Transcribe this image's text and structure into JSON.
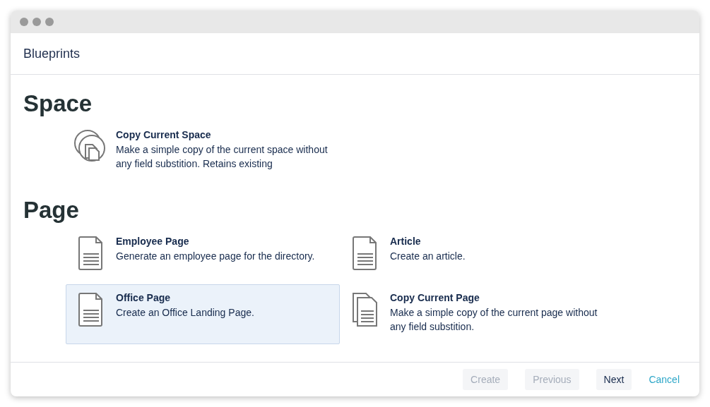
{
  "window": {
    "title": "Blueprints"
  },
  "sections": [
    {
      "heading": "Space",
      "items": [
        {
          "kind": "space",
          "title": "Copy Current Space",
          "description": "Make a simple copy of the current space without any field substition. Retains existing",
          "selected": false
        }
      ]
    },
    {
      "heading": "Page",
      "items": [
        {
          "kind": "page",
          "title": "Employee Page",
          "description": "Generate an employee page for the directory.",
          "selected": false
        },
        {
          "kind": "page",
          "title": "Article",
          "description": "Create an article.",
          "selected": false
        },
        {
          "kind": "page",
          "title": "Office Page",
          "description": "Create an Office Landing Page.",
          "selected": true
        },
        {
          "kind": "pages",
          "title": "Copy Current Page",
          "description": "Make a simple copy of the current page without any field substition.",
          "selected": false
        }
      ]
    }
  ],
  "buttons": [
    {
      "kind": "button",
      "label": "Create",
      "disabled": true
    },
    {
      "kind": "button",
      "label": "Previous",
      "disabled": true
    },
    {
      "kind": "button",
      "label": "Next",
      "disabled": false
    },
    {
      "kind": "link",
      "label": "Cancel",
      "disabled": false
    }
  ]
}
